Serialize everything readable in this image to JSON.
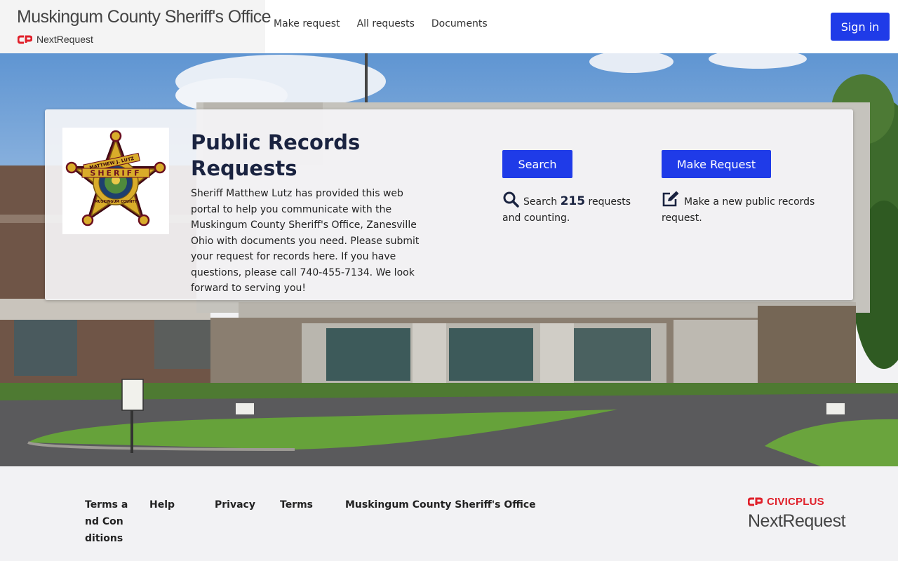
{
  "header": {
    "agency_name": "Muskingum County Sheriff's Office",
    "product_name": "NextRequest",
    "nav": [
      {
        "label": "Make request"
      },
      {
        "label": "All requests"
      },
      {
        "label": "Documents"
      }
    ],
    "sign_in_label": "Sign in",
    "logo_icon": "civicplus-logo-icon"
  },
  "hero": {
    "badge_icon": "sheriff-star-badge",
    "badge_text": {
      "top": "MATTHEW J. LUTZ",
      "middle": "SHERIFF",
      "bottom": "MUSKINGUM COUNTY"
    },
    "title": "Public Records Requests",
    "description": "Sheriff Matthew Lutz has provided this web portal to help you communicate with the Muskingum County Sheriff's Office, Zanesville Ohio with documents you need. Please submit your request for records here. If you have questions, please call 740-455-7134. We look forward to serving you!",
    "search": {
      "button_label": "Search",
      "icon": "magnifying-glass-icon",
      "text_before": "Search",
      "count": "215",
      "text_after": "requests and counting."
    },
    "make_request": {
      "button_label": "Make Request",
      "icon": "edit-icon",
      "text": "Make a new public records request."
    }
  },
  "footer": {
    "links": [
      {
        "label": "Terms and Conditions"
      },
      {
        "label": "Help"
      },
      {
        "label": "Privacy"
      },
      {
        "label": "Terms"
      },
      {
        "label": "Muskingum County Sheriff's Office"
      }
    ],
    "civicplus_label": "CIVICPLUS",
    "nextrequest_label": "NextRequest"
  },
  "colors": {
    "primary": "#1f3be8",
    "title_navy": "#1a2340",
    "civic_red": "#e0202a",
    "footer_bg": "#f2f2f4"
  }
}
